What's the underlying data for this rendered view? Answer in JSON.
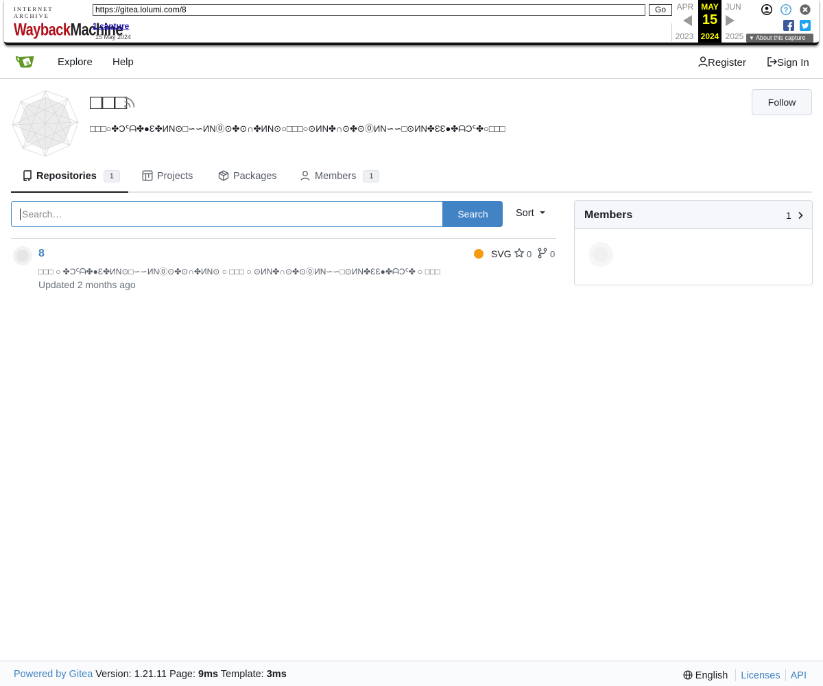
{
  "wayback": {
    "logo_top": "INTERNET ARCHIVE",
    "logo_main_a": "Wayback",
    "logo_main_b": "Machine",
    "url": "https://gitea.lolumi.com/8",
    "go": "Go",
    "captures": "1 capture",
    "capture_date": "15 May 2024",
    "prev_month": "APR",
    "cur_month": "MAY",
    "next_month": "JUN",
    "day": "15",
    "prev_year": "2023",
    "cur_year": "2024",
    "next_year": "2025",
    "about": "About this capture",
    "icons": [
      "user-icon",
      "help-icon",
      "close-icon",
      "facebook-icon",
      "twitter-icon"
    ]
  },
  "nav": {
    "explore": "Explore",
    "help": "Help",
    "register": "Register",
    "sign_in": "Sign In"
  },
  "org": {
    "name": "□□□",
    "description": "□□□○✤Ɔᑦᗩ✤●Ɛ✤ИN⊙□∽∽ИN⓪⊙✤⊙∩✤ИN⊙○□□□○⊙ИN✤∩⊙✤⊙⓪ИN∽∽□⊙ИN✤ƐƐ●✤ᗩƆᑦ✤○□□□",
    "follow": "Follow"
  },
  "tabs": [
    {
      "label": "Repositories",
      "count": "1"
    },
    {
      "label": "Projects"
    },
    {
      "label": "Packages"
    },
    {
      "label": "Members",
      "count": "1"
    }
  ],
  "search": {
    "placeholder": "Search…",
    "button": "Search",
    "sort": "Sort"
  },
  "repos": [
    {
      "name": "8",
      "language": "SVG",
      "language_color": "#f39c12",
      "stars": "0",
      "forks": "0",
      "description": "□□□ ○ ✤Ɔᑦᗩ✤●Ɛ✤ИN⊙□∽∽ИN⓪⊙✤⊙∩✤ИN⊙ ○ □□□ ○ ⊙ИN✤∩⊙✤⊙⓪ИN∽∽□⊙ИN✤ƐƐ●✤ᗩƆᑦ✤ ○ □□□",
      "updated": "Updated 2 months ago"
    }
  ],
  "members_card": {
    "title": "Members",
    "count": "1"
  },
  "footer": {
    "powered": "Powered by Gitea",
    "version_label": "Version:",
    "version": "1.21.11",
    "page_label": "Page:",
    "page_time": "9ms",
    "template_label": "Template:",
    "template_time": "3ms",
    "language": "English",
    "licenses": "Licenses",
    "api": "API"
  },
  "colors": {
    "accent": "#4183c4",
    "wayback_red": "#b0101a",
    "wayback_yellow": "#ffff00"
  }
}
